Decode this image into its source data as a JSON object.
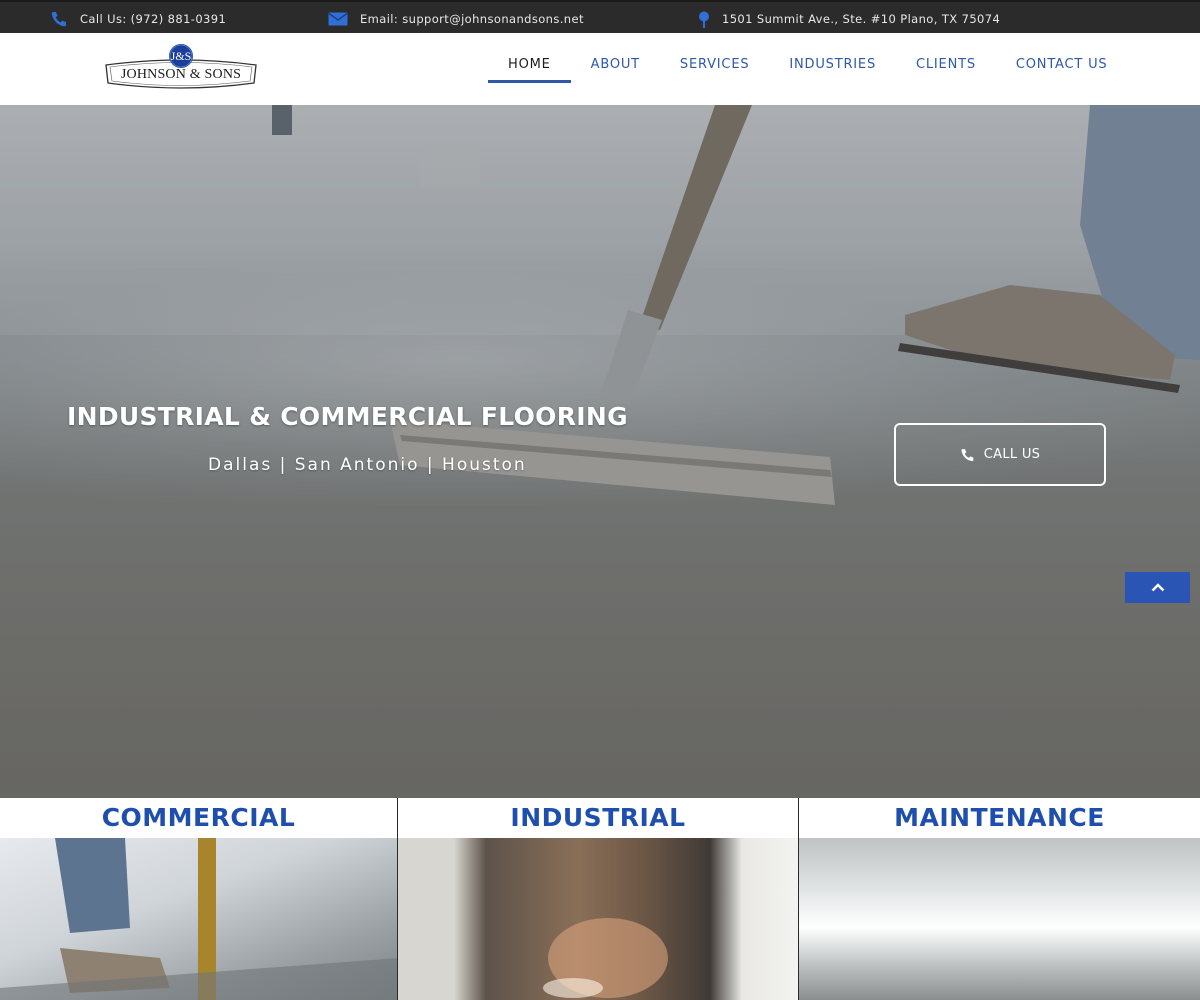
{
  "topbar": {
    "phone": "Call Us: (972) 881-0391",
    "email": "Email: support@johnsonandsons.net",
    "address": "1501 Summit Ave., Ste. #10 Plano, TX 75074"
  },
  "logo": {
    "monogram": "J&S",
    "name": "JOHNSON & SONS"
  },
  "nav": {
    "items": [
      "HOME",
      "ABOUT",
      "SERVICES",
      "INDUSTRIES",
      "CLIENTS",
      "CONTACT US"
    ],
    "active": "HOME"
  },
  "hero": {
    "title": "INDUSTRIAL & COMMERCIAL FLOORING",
    "cities": "Dallas | San Antonio | Houston",
    "button_label": "CALL US"
  },
  "tiles": [
    {
      "title": "COMMERCIAL"
    },
    {
      "title": "INDUSTRIAL"
    },
    {
      "title": "MAINTENANCE"
    }
  ],
  "colors": {
    "accent": "#2f58a8",
    "topbar_bg": "#2b2b2b",
    "tile_title": "#1f4fae",
    "scroll_button": "#2b55b5"
  },
  "icons": {
    "phone": "phone-icon",
    "email": "envelope-icon",
    "address": "map-pin-icon",
    "scroll_top": "chevron-up-icon"
  }
}
